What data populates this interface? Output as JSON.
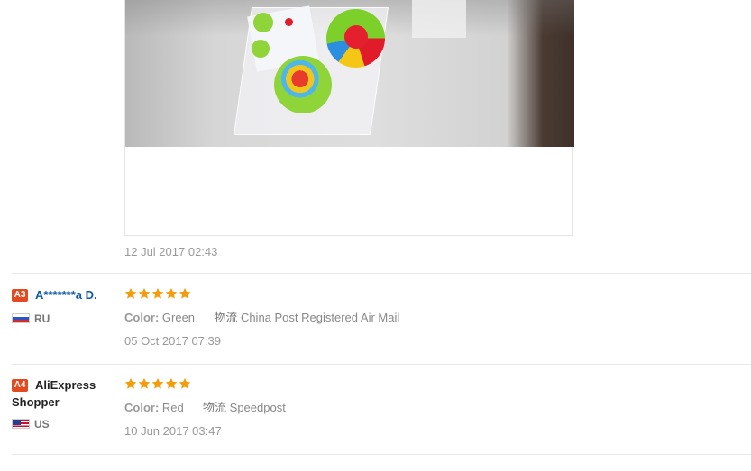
{
  "reviews": [
    {
      "photo_time": "12 Jul 2017 02:43"
    },
    {
      "badge": "A3",
      "name": "A*******a D.",
      "country": "RU",
      "rating": 5,
      "color_label": "Color:",
      "color_value": "Green",
      "shipping_label": "物流",
      "shipping_value": "China Post Registered Air Mail",
      "time": "05 Oct 2017 07:39"
    },
    {
      "badge": "A4",
      "name": "AliExpress Shopper",
      "country": "US",
      "rating": 5,
      "color_label": "Color:",
      "color_value": "Red",
      "shipping_label": "物流",
      "shipping_value": "Speedpost",
      "time": "10 Jun 2017 03:47"
    }
  ],
  "colors": {
    "star": "#f59c0b",
    "badge": "#e24b1f",
    "masked_name": "#0f5ba8"
  }
}
